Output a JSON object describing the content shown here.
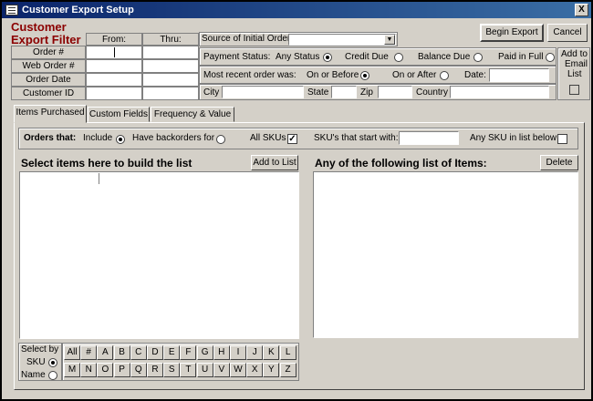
{
  "window": {
    "title": "Customer Export Setup",
    "close_glyph": "X"
  },
  "filter": {
    "heading_line1": "Customer",
    "heading_line2": "Export Filter",
    "from_header": "From:",
    "thru_header": "Thru:",
    "rows": [
      "Order #",
      "Web Order #",
      "Order Date",
      "Customer ID"
    ]
  },
  "source": {
    "label": "Source of Initial Order",
    "value": ""
  },
  "buttons": {
    "begin_export": "Begin Export",
    "cancel": "Cancel",
    "add_to_list": "Add to List",
    "delete": "Delete"
  },
  "payment": {
    "label": "Payment Status:",
    "options": [
      "Any Status",
      "Credit Due",
      "Balance Due",
      "Paid in Full"
    ],
    "selected": "Any Status"
  },
  "recent_order": {
    "label": "Most recent order was:",
    "on_before": "On or Before",
    "on_after": "On or After",
    "date_label": "Date:",
    "date_value": ""
  },
  "address": {
    "city": "City",
    "state": "State",
    "zip": "Zip",
    "country": "Country"
  },
  "email_list": {
    "line1": "Add to",
    "line2": "Email",
    "line3": "List"
  },
  "tabs": [
    "Items Purchased",
    "Custom Fields",
    "Frequency & Value"
  ],
  "orders": {
    "label": "Orders that:",
    "include": "Include",
    "backorders": "Have backorders for",
    "all_skus": "All SKUs",
    "sku_starts": "SKU's that start with:",
    "any_sku": "Any SKU in list below",
    "sku_prefix_value": ""
  },
  "left_panel": {
    "heading": "Select items here to build the list"
  },
  "right_panel": {
    "heading": "Any of the following list of Items:"
  },
  "select_by": {
    "line1": "Select by",
    "sku": "SKU",
    "name": "Name"
  },
  "letters_row1": [
    "All",
    "#",
    "A",
    "B",
    "C",
    "D",
    "E",
    "F",
    "G",
    "H",
    "I",
    "J",
    "K",
    "L"
  ],
  "letters_row2": [
    "M",
    "N",
    "O",
    "P",
    "Q",
    "R",
    "S",
    "T",
    "U",
    "V",
    "W",
    "X",
    "Y",
    "Z"
  ]
}
